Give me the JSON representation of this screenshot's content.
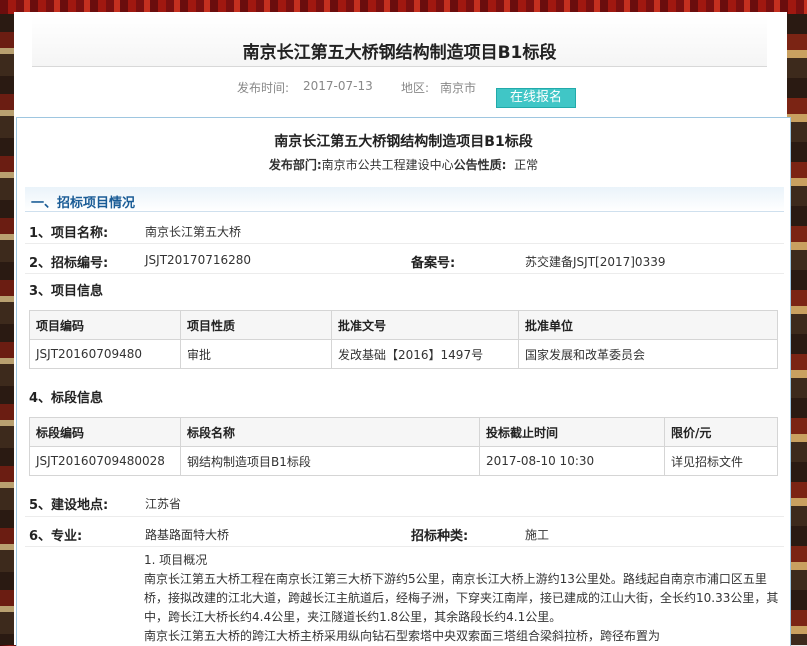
{
  "title": "南京长江第五大桥钢结构制造项目B1标段",
  "meta": {
    "date_label": "发布时间:",
    "date": "2017-07-13",
    "region_label": "地区:",
    "region": "南京市",
    "signup": "在线报名"
  },
  "content": {
    "title": "南京长江第五大桥钢结构制造项目B1标段",
    "dept_label": "发布部门:",
    "dept": "南京市公共工程建设中心",
    "nature_label": "公告性质:",
    "nature": "正常",
    "section1": "一、招标项目情况",
    "project_name_label": "1、项目名称:",
    "project_name": "南京长江第五大桥",
    "bid_no_label": "2、招标编号:",
    "bid_no": "JSJT20170716280",
    "record_label": "备案号:",
    "record": "苏交建备JSJT[2017]0339",
    "project_info_label": "3、项目信息",
    "project_table": {
      "headers": [
        "项目编码",
        "项目性质",
        "批准文号",
        "批准单位"
      ],
      "row": [
        "JSJT20160709480",
        "审批",
        "发改基础【2016】1497号",
        "国家发展和改革委员会"
      ]
    },
    "lot_info_label": "4、标段信息",
    "lot_table": {
      "headers": [
        "标段编码",
        "标段名称",
        "投标截止时间",
        "限价/元"
      ],
      "row": [
        "JSJT20160709480028",
        "钢结构制造项目B1标段",
        "2017-08-10 10:30",
        "详见招标文件"
      ]
    },
    "location_label": "5、建设地点:",
    "location": "江苏省",
    "specialty_label": "6、专业:",
    "specialty": "路基路面特大桥",
    "bid_type_label": "招标种类:",
    "bid_type": "施工",
    "desc_heading": "1. 项目概况",
    "desc_p1": "南京长江第五大桥工程在南京长江第三大桥下游约5公里，南京长江大桥上游约13公里处。路线起自南京市浦口区五里桥，接拟改建的江北大道，跨越长江主航道后，经梅子洲，下穿夹江南岸，接已建成的江山大街，全长约10.33公里，其中，跨长江大桥长约4.4公里，夹江隧道长约1.8公里，其余路段长约4.1公里。",
    "desc_p2": "南京长江第五大桥的跨江大桥主桥采用纵向钻石型索塔中央双索面三塔组合梁斜拉桥，跨径布置为"
  }
}
